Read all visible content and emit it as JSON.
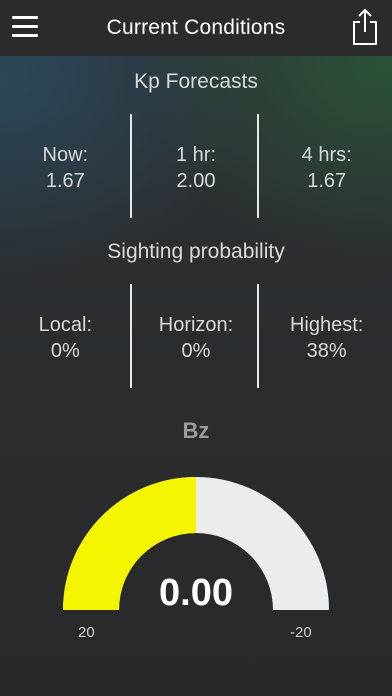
{
  "header": {
    "title": "Current Conditions"
  },
  "kp": {
    "title": "Kp Forecasts",
    "columns": [
      {
        "label": "Now:",
        "value": "1.67"
      },
      {
        "label": "1 hr:",
        "value": "2.00"
      },
      {
        "label": "4 hrs:",
        "value": "1.67"
      }
    ]
  },
  "sighting": {
    "title": "Sighting probability",
    "columns": [
      {
        "label": "Local:",
        "value": "0%"
      },
      {
        "label": "Horizon:",
        "value": "0%"
      },
      {
        "label": "Highest:",
        "value": "38%"
      }
    ]
  },
  "bz": {
    "label": "Bz",
    "value": "0.00",
    "min_label": "20",
    "max_label": "-20",
    "fill_fraction": 0.5,
    "fill_color": "#f5f500",
    "track_color": "#ececec"
  }
}
